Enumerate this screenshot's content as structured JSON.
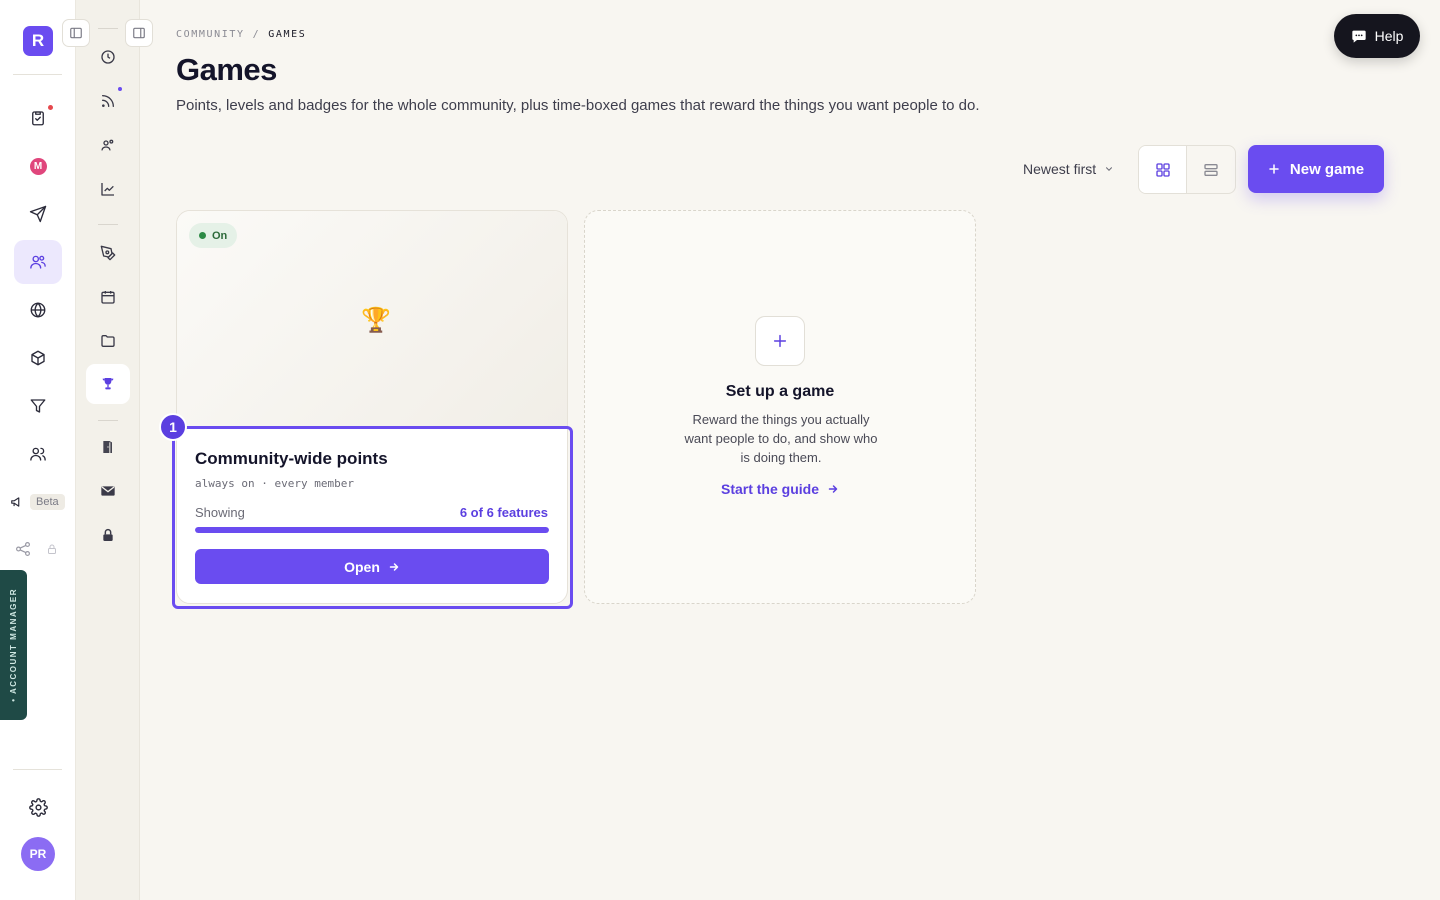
{
  "rail": {
    "logo_letter": "R",
    "beta_label": "Beta",
    "account_manager_label": "• ACCOUNT MANAGER",
    "avatar_initials": "PR",
    "m_badge": "M"
  },
  "breadcrumb": {
    "parent": "COMMUNITY",
    "separator": "/",
    "current": "GAMES"
  },
  "page": {
    "title": "Games",
    "subtitle": "Points, levels and badges for the whole community, plus time-boxed games that reward the things you want people to do."
  },
  "help": {
    "label": "Help"
  },
  "toolbar": {
    "sort_label": "Newest first",
    "new_game_label": "New game"
  },
  "game_card": {
    "status": "On",
    "step": "1",
    "title": "Community-wide points",
    "meta": "always on · every member",
    "progress_label": "Showing",
    "progress_value": "6 of 6 features",
    "progress_fraction": 1.0,
    "open_label": "Open"
  },
  "setup_card": {
    "title": "Set up a game",
    "description": "Reward the things you actually want people to do, and show who is doing them.",
    "link_label": "Start the guide"
  },
  "colors": {
    "accent": "#6a4cf0",
    "status_on": "#2c8a45",
    "background": "#f8f6f1"
  }
}
